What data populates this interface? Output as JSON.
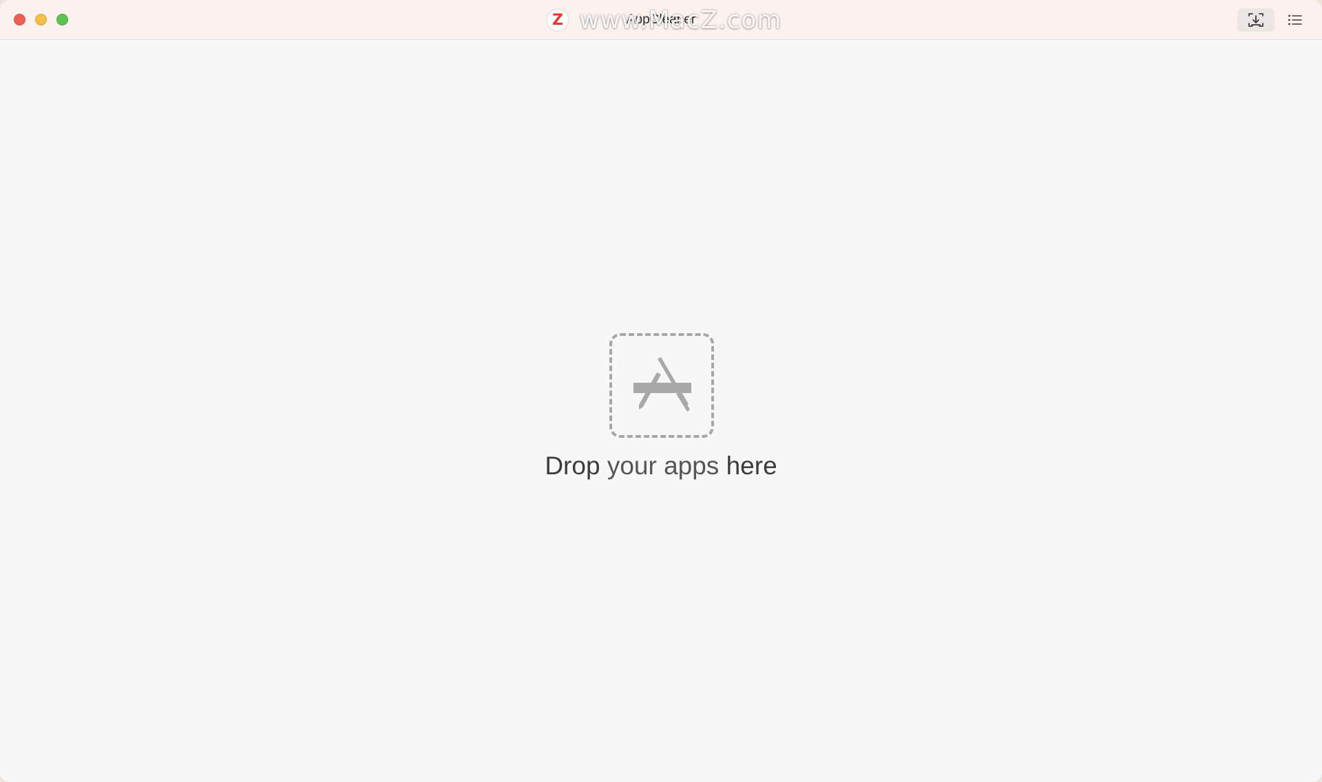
{
  "window": {
    "title": "AppCleaner",
    "watermark_logo": "Z",
    "watermark_text": "www.MacZ.com"
  },
  "traffic_lights": {
    "close": "#ec5f57",
    "minimize": "#f0be4a",
    "zoom": "#5fc353"
  },
  "toolbar": {
    "import_icon": "import-tray-icon",
    "list_icon": "list-icon"
  },
  "main": {
    "drop_icon": "app-store-icon",
    "drop_text_part1": "Drop",
    "drop_text_part2": "your apps",
    "drop_text_part3": "here"
  },
  "colors": {
    "window_bg": "#f7f7f7",
    "titlebar_bg": "#fbf1ee",
    "icon_gray": "#a8a8a8",
    "watermark_accent": "#e8372f"
  }
}
